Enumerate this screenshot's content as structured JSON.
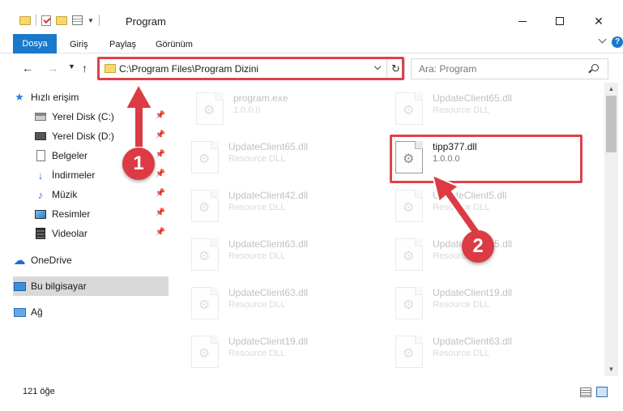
{
  "window": {
    "title": "Program",
    "minimize_label": "",
    "maximize_label": "",
    "close_label": "✕"
  },
  "ribbon": {
    "tabs": [
      "Dosya",
      "Giriş",
      "Paylaş",
      "Görünüm"
    ],
    "help_label": "?"
  },
  "navigation": {
    "address_path": "C:\\Program Files\\Program Dizini",
    "search_placeholder": "Ara: Program",
    "refresh_label": "↻"
  },
  "sidebar": {
    "quick_access": "Hızlı erişim",
    "pinned": [
      {
        "label": "Yerel Disk (C:)",
        "icon": "drive-icon"
      },
      {
        "label": "Yerel Disk (D:)",
        "icon": "drive-icon"
      },
      {
        "label": "Belgeler",
        "icon": "documents-icon"
      },
      {
        "label": "İndirmeler",
        "icon": "downloads-icon"
      },
      {
        "label": "Müzik",
        "icon": "music-icon"
      },
      {
        "label": "Resimler",
        "icon": "pictures-icon"
      },
      {
        "label": "Videolar",
        "icon": "videos-icon"
      }
    ],
    "onedrive": "OneDrive",
    "this_pc": "Bu bilgisayar",
    "network": "Ağ"
  },
  "files": [
    {
      "name": "program.exe",
      "sub": "1.0.0.0",
      "faded": true
    },
    {
      "name": "UpdateClient65.dll",
      "sub": "Resource DLL",
      "faded": true
    },
    {
      "name": "UpdateClient65.dll",
      "sub": "Resource DLL",
      "faded": true
    },
    {
      "name": "tipp377.dll",
      "sub": "1.0.0.0",
      "faded": false
    },
    {
      "name": "UpdateClient42.dll",
      "sub": "Resource DLL",
      "faded": true
    },
    {
      "name": "UpdateClient5.dll",
      "sub": "Resource DLL",
      "faded": true
    },
    {
      "name": "UpdateClient63.dll",
      "sub": "Resource DLL",
      "faded": true
    },
    {
      "name": "UpdateClient65.dll",
      "sub": "Resource DLL",
      "faded": true
    },
    {
      "name": "UpdateClient63.dll",
      "sub": "Resource DLL",
      "faded": true
    },
    {
      "name": "UpdateClient65.dll",
      "sub": "Resource DLL",
      "faded": true
    },
    {
      "name": "UpdateClient65.dll",
      "sub": "Resource DLL",
      "faded": true
    },
    {
      "name": "UpdateClient19.dll",
      "sub": "Resource DLL",
      "faded": true
    },
    {
      "name": "UpdateClient19.dll",
      "sub": "Resource DLL",
      "faded": true
    },
    {
      "name": "UpdateClient63.dll",
      "sub": "Resource DLL",
      "faded": true
    }
  ],
  "status": {
    "item_count": "121 öğe"
  },
  "annotations": {
    "step1": "1",
    "step2": "2",
    "color": "#e0414a"
  }
}
